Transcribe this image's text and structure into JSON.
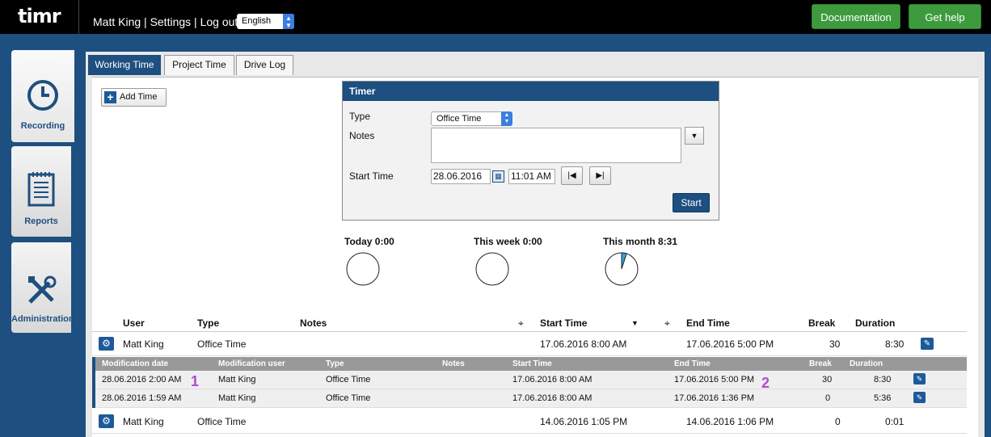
{
  "topbar": {
    "logo": "timr",
    "user_name": "Matt King",
    "settings_link": "Settings",
    "logout_link": "Log out",
    "separator": "|",
    "language": "English",
    "documentation_label": "Documentation",
    "help_label": "Get help"
  },
  "sidebar": {
    "items": [
      {
        "label": "Recording",
        "icon": "clock-icon"
      },
      {
        "label": "Reports",
        "icon": "notepad-icon"
      },
      {
        "label": "Administration",
        "icon": "tools-icon"
      }
    ]
  },
  "tabs": [
    {
      "label": "Working Time",
      "active": true
    },
    {
      "label": "Project Time",
      "active": false
    },
    {
      "label": "Drive Log",
      "active": false
    }
  ],
  "add_time_label": "Add Time",
  "timer": {
    "title": "Timer",
    "type_label": "Type",
    "type_value": "Office Time",
    "notes_label": "Notes",
    "notes_value": "",
    "start_time_label": "Start Time",
    "start_date": "28.06.2016",
    "start_clock": "11:01 AM",
    "start_button": "Start"
  },
  "stats": [
    {
      "label": "Today 0:00",
      "fraction": 0
    },
    {
      "label": "This week 0:00",
      "fraction": 0
    },
    {
      "label": "This month 8:31",
      "fraction": 0.05
    }
  ],
  "grid": {
    "headers": {
      "user": "User",
      "type": "Type",
      "notes": "Notes",
      "start_time": "Start Time",
      "end_time": "End Time",
      "break": "Break",
      "duration": "Duration"
    },
    "rows": [
      {
        "user": "Matt King",
        "type": "Office Time",
        "notes": "",
        "start": "17.06.2016 8:00 AM",
        "end": "17.06.2016 5:00 PM",
        "break": "30",
        "duration": "8:30"
      },
      {
        "user": "Matt King",
        "type": "Office Time",
        "notes": "",
        "start": "14.06.2016 1:05 PM",
        "end": "14.06.2016 1:06 PM",
        "break": "0",
        "duration": "0:01"
      }
    ]
  },
  "history": {
    "headers": {
      "mod_date": "Modification date",
      "mod_user": "Modification user",
      "type": "Type",
      "notes": "Notes",
      "start_time": "Start Time",
      "end_time": "End Time",
      "break": "Break",
      "duration": "Duration"
    },
    "rows": [
      {
        "mod_date": "28.06.2016 2:00 AM",
        "mod_user": "Matt King",
        "type": "Office Time",
        "notes": "",
        "start": "17.06.2016 8:00 AM",
        "end": "17.06.2016 5:00 PM",
        "break": "30",
        "duration": "8:30"
      },
      {
        "mod_date": "28.06.2016 1:59 AM",
        "mod_user": "Matt King",
        "type": "Office Time",
        "notes": "",
        "start": "17.06.2016 8:00 AM",
        "end": "17.06.2016 1:36 PM",
        "break": "0",
        "duration": "5:36"
      }
    ]
  },
  "annotations": {
    "marker_1": "1",
    "marker_2": "2"
  },
  "colors": {
    "brand_blue": "#1d4f80",
    "button_green": "#3d9b3d",
    "annotation_purple": "#b347d6"
  }
}
